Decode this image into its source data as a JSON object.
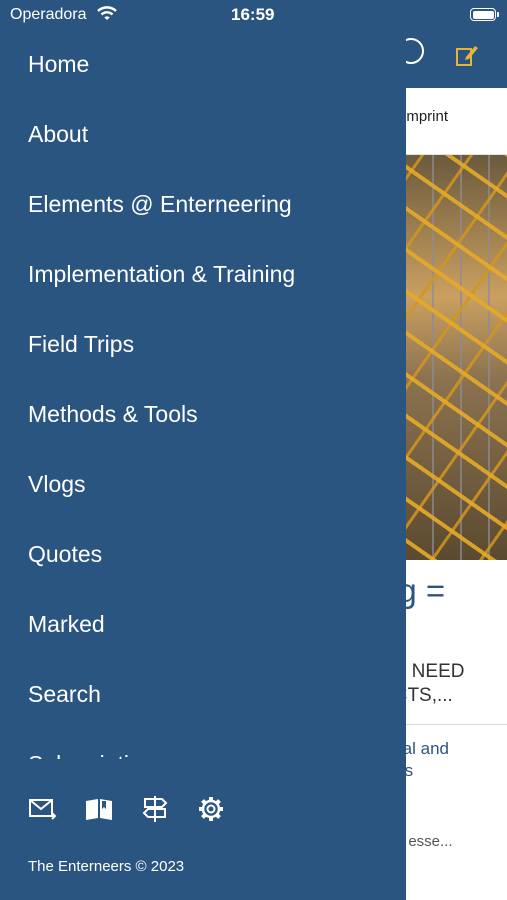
{
  "status_bar": {
    "carrier": "Operadora",
    "time": "16:59"
  },
  "menu": {
    "items": [
      {
        "label": "Home"
      },
      {
        "label": "About"
      },
      {
        "label": "Elements @ Enterneering"
      },
      {
        "label": "Implementation & Training"
      },
      {
        "label": "Field Trips"
      },
      {
        "label": "Methods & Tools"
      },
      {
        "label": "Vlogs"
      },
      {
        "label": "Quotes"
      },
      {
        "label": "Marked"
      },
      {
        "label": "Search"
      },
      {
        "label": "Subscriptions"
      }
    ]
  },
  "toolbar": {
    "icons": [
      "mail-forward-icon",
      "book-icon",
      "signpost-icon",
      "gear-icon"
    ]
  },
  "footer": {
    "text": "The Enterneers  © 2023"
  },
  "background": {
    "subbar_text": "& Imprint",
    "title": "ng =",
    "caps_line1": "RS NEED",
    "caps_line2": "UCTS,...",
    "link_line1": "ional and",
    "link_line2": "ures",
    "small_line1": "e",
    "small_line2": "arly esse..."
  },
  "colors": {
    "drawer": "#2b5581",
    "text": "#ffffff"
  }
}
